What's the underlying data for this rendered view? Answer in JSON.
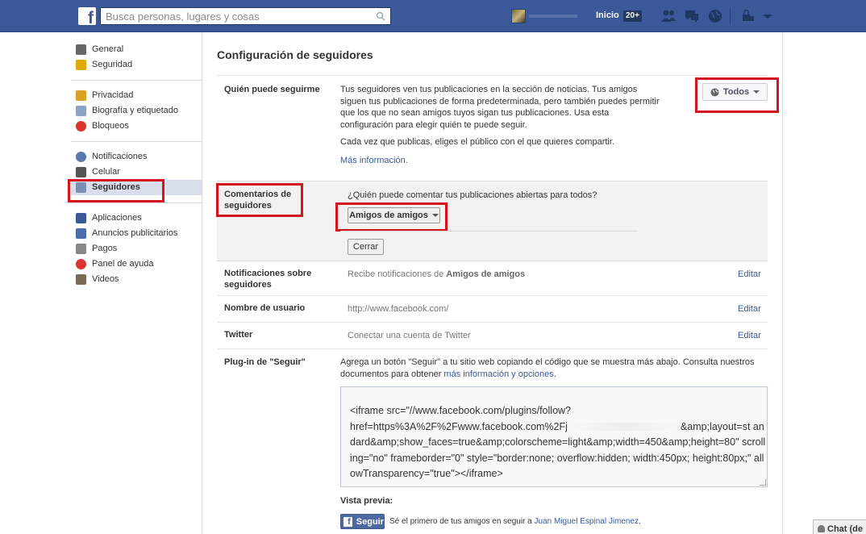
{
  "topbar": {
    "search_placeholder": "Busca personas, lugares y cosas",
    "home_label": "Inicio",
    "home_count": "20+",
    "logo_letter": "f"
  },
  "sidebar": {
    "groups": [
      [
        {
          "label": "General",
          "icon": "gears-icon"
        },
        {
          "label": "Seguridad",
          "icon": "badge-icon"
        }
      ],
      [
        {
          "label": "Privacidad",
          "icon": "lock-icon"
        },
        {
          "label": "Biografía y etiquetado",
          "icon": "timeline-icon"
        },
        {
          "label": "Bloqueos",
          "icon": "block-icon"
        }
      ],
      [
        {
          "label": "Notificaciones",
          "icon": "globe-icon"
        },
        {
          "label": "Celular",
          "icon": "phone-icon"
        },
        {
          "label": "Seguidores",
          "icon": "rss-icon",
          "active": true
        }
      ],
      [
        {
          "label": "Aplicaciones",
          "icon": "apps-icon"
        },
        {
          "label": "Anuncios publicitarios",
          "icon": "ads-icon"
        },
        {
          "label": "Pagos",
          "icon": "card-icon"
        },
        {
          "label": "Panel de ayuda",
          "icon": "lifebuoy-icon"
        },
        {
          "label": "Videos",
          "icon": "film-icon"
        }
      ]
    ]
  },
  "main": {
    "title": "Configuración de seguidores",
    "who_follow": {
      "label": "Quién puede seguirme",
      "description": "Tus seguidores ven tus publicaciones en la sección de noticias. Tus amigos siguen tus publicaciones de forma predeterminada, pero también puedes permitir que los que no sean amigos tuyos sigan tus publicaciones. Usa esta configuración para elegir quién te puede seguir.",
      "note": "Cada vez que publicas, eliges el público con el que quieres compartir.",
      "more_link": "Más información.",
      "selector": "Todos"
    },
    "comments": {
      "label": "Comentarios de seguidores",
      "question": "¿Quién puede comentar tus publicaciones abiertas para todos?",
      "selector": "Amigos de amigos",
      "close_button": "Cerrar"
    },
    "notifications": {
      "label": "Notificaciones sobre seguidores",
      "text_prefix": "Recibe notificaciones de ",
      "text_bold": "Amigos de amigos",
      "edit": "Editar"
    },
    "username": {
      "label": "Nombre de usuario",
      "value": "http://www.facebook.com/",
      "edit": "Editar"
    },
    "twitter": {
      "label": "Twitter",
      "value": "Conectar una cuenta de Twitter",
      "edit": "Editar"
    },
    "plugin": {
      "label": "Plug-in de \"Seguir\"",
      "description": "Agrega un botón \"Seguir\" a tu sitio web copiando el código que se muestra más abajo. Consulta nuestros documentos para obtener ",
      "description_link": "más información y opciones",
      "description_end": ".",
      "code_part1": "<iframe src=\"//www.facebook.com/plugins/follow?\nhref=https%3A%2F%2Fwww.facebook.com%2Fj",
      "code_part2": "&amp;layout=st andard&amp;show_faces=true&amp;colorscheme=light&amp;width=450&amp;height=80\" scrolling=\"no\" frameborder=\"0\" style=\"border:none; overflow:hidden; width:450px; height:80px;\" allowTransparency=\"true\"></iframe>",
      "preview_label": "Vista previa:",
      "follow_button": "Seguir",
      "preview_text": "Sé el primero de tus amigos en seguir a ",
      "preview_name": "Juan Miguel Espinal Jimenez",
      "preview_end": "."
    }
  },
  "chat": {
    "label": "Chat (de"
  },
  "colors": {
    "brand": "#3b5998",
    "highlight": "#d5141f"
  }
}
